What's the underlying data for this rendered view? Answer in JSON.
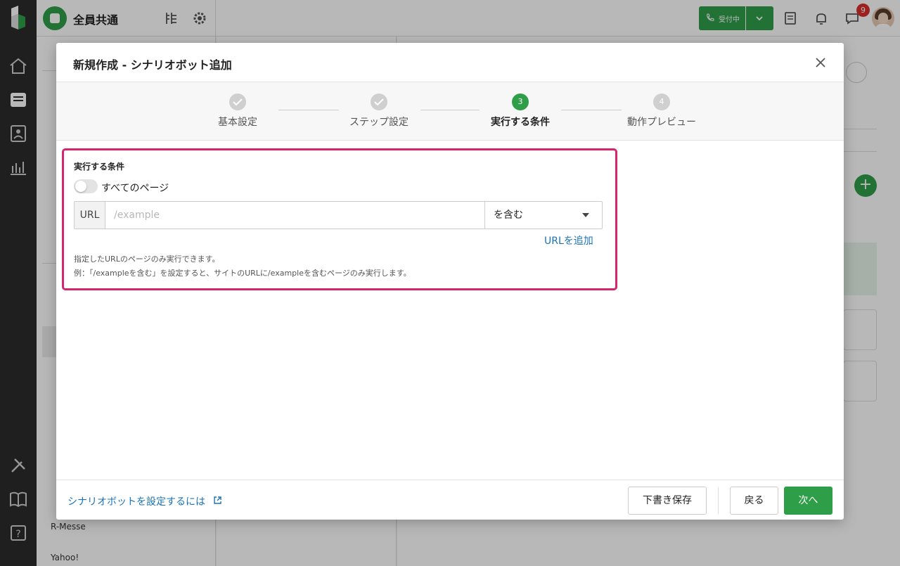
{
  "app": {
    "workspace_name": "全員共通",
    "reception_status": "受付中",
    "notification_count": "9"
  },
  "sidebar_bg": {
    "visible_items": [
      "R-Messe",
      "Yahoo!"
    ]
  },
  "modal": {
    "title": "新規作成 - シナリオボット追加",
    "steps": [
      {
        "label": "基本設定",
        "state": "done"
      },
      {
        "label": "ステップ設定",
        "state": "done"
      },
      {
        "number": "3",
        "label": "実行する条件",
        "state": "active"
      },
      {
        "number": "4",
        "label": "動作プレビュー",
        "state": "pending"
      }
    ],
    "section": {
      "title": "実行する条件",
      "toggle_label": "すべてのページ",
      "url_prefix": "URL",
      "url_placeholder": "/example",
      "match_type": "を含む",
      "add_url_label": "URLを追加",
      "help_line1": "指定したURLのページのみ実行できます。",
      "help_line2": "例：「/exampleを含む」を設定すると、サイトのURLに/exampleを含むページのみ実行します。"
    },
    "footer": {
      "help_link": "シナリオボットを設定するには",
      "save_draft_label": "下書き保存",
      "back_label": "戻る",
      "next_label": "次へ"
    }
  },
  "colors": {
    "brand_green": "#2e9e48",
    "highlight_border": "#d6246e",
    "link_blue": "#1a73b8",
    "badge_red": "#d9302c"
  }
}
